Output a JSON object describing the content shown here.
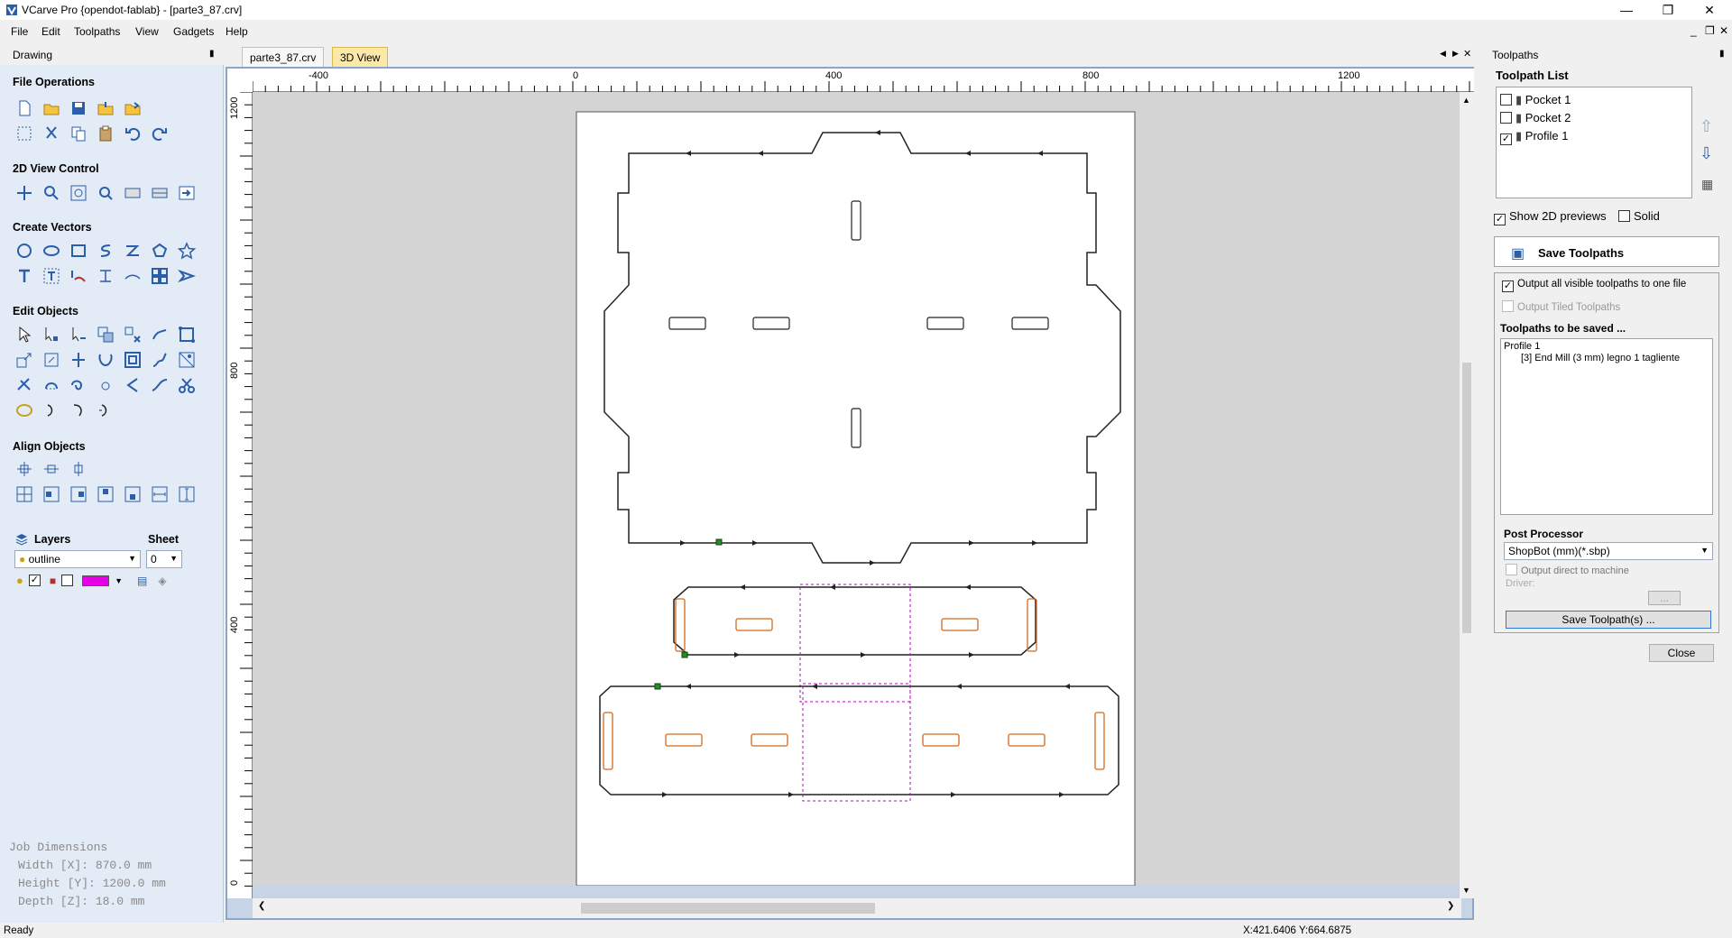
{
  "window": {
    "title": "VCarve Pro {opendot-fablab} - [parte3_87.crv]",
    "minimize": "—",
    "maximize": "❐",
    "close": "✕"
  },
  "menu": [
    "File",
    "Edit",
    "Toolpaths",
    "View",
    "Gadgets",
    "Help"
  ],
  "mdi_controls": {
    "minimize": "_",
    "restore": "❐",
    "close": "✕"
  },
  "drawing_panel": {
    "title": "Drawing",
    "pin": "▮",
    "sections": {
      "file_operations": "File Operations",
      "view_control": "2D View Control",
      "create_vectors": "Create Vectors",
      "edit_objects": "Edit Objects",
      "align_objects": "Align Objects",
      "layers": "Layers",
      "sheet": "Sheet"
    },
    "layer_select": "outline",
    "sheet_select": "0",
    "layer_color": "#e600e6",
    "job_dimensions": {
      "title": "Job Dimensions",
      "width": "Width  [X]: 870.0 mm",
      "height": "Height [Y]: 1200.0 mm",
      "depth": "Depth  [Z]: 18.0 mm"
    }
  },
  "tabs": {
    "active": "parte3_87.crv",
    "other": "3D View"
  },
  "nav": {
    "prev": "◀",
    "next": "▶",
    "close": "✕"
  },
  "rulers": {
    "top": [
      "-400",
      "0",
      "400",
      "800",
      "1200"
    ],
    "left": [
      "1200",
      "800",
      "400",
      "0"
    ]
  },
  "toolpaths_panel": {
    "title": "Toolpaths",
    "pin": "▮",
    "list_title": "Toolpath List",
    "items": [
      {
        "label": "Pocket 1",
        "checked": false
      },
      {
        "label": "Pocket 2",
        "checked": false
      },
      {
        "label": "Profile 1",
        "checked": true
      }
    ],
    "show_2d_previews": "Show 2D previews",
    "solid": "Solid",
    "save_title": "Save Toolpaths",
    "output_all": "Output all visible toolpaths to one file",
    "output_tiled": "Output Tiled Toolpaths",
    "to_be_saved_title": "Toolpaths to be saved ...",
    "saved_list": [
      "Profile 1",
      "[3] End Mill (3 mm) legno 1 tagliente"
    ],
    "post_processor_title": "Post Processor",
    "post_processor": "ShopBot (mm)(*.sbp)",
    "output_direct": "Output direct to machine",
    "driver": "Driver:",
    "driver_btn": "...",
    "save_button": "Save Toolpath(s) ...",
    "close_button": "Close"
  },
  "status": {
    "left": "Ready",
    "coords": "X:421.6406 Y:664.6875"
  },
  "colors": {
    "panel_bg": "#e3ebf6",
    "accent": "#2b5ea8",
    "vector": "#222222",
    "pocket": "#d2691e",
    "selection": "#c000c0"
  }
}
